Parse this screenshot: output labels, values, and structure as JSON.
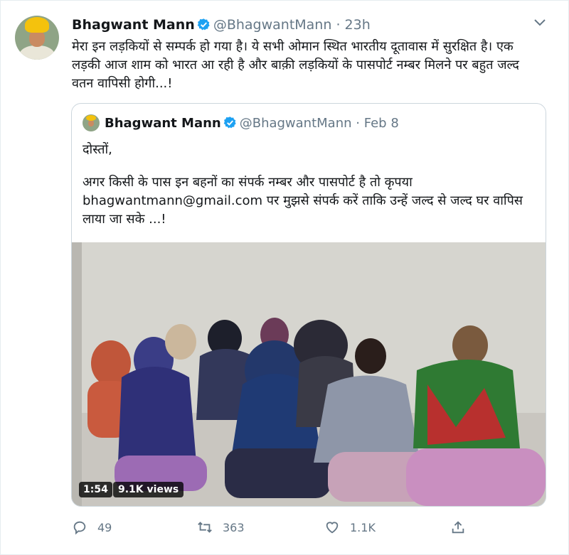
{
  "tweet": {
    "author_name": "Bhagwant Mann",
    "handle": "@BhagwantMann",
    "separator": "·",
    "time": "23h",
    "text": "मेरा इन लड़कियों से सम्पर्क हो गया है। ये सभी ओमान स्थित भारतीय दूतावास में सुरक्षित है। एक लड़की आज शाम को भारत आ रही है और बाक़ी लड़कियों के पासपोर्ट नम्बर मिलने पर  बहुत जल्द वतन वापिसी होगी...!",
    "icons": {
      "verified": "verified-badge-icon",
      "more": "chevron-down-icon"
    }
  },
  "quoted": {
    "author_name": "Bhagwant Mann",
    "handle": "@BhagwantMann",
    "separator": "·",
    "date": "Feb 8",
    "line1": "दोस्तों,",
    "line2": "अगर किसी के पास इन बहनों का संपर्क नम्बर और पासपोर्ट है तो कृपया bhagwantmann@gmail.com पर मुझसे संपर्क करें ताकि उन्हें जल्द से जल्द घर वापिस लाया जा सके ...!",
    "video": {
      "duration": "1:54",
      "views": "9.1K views"
    }
  },
  "actions": {
    "reply_count": "49",
    "retweet_count": "363",
    "like_count": "1.1K",
    "icons": [
      "reply-icon",
      "retweet-icon",
      "like-icon",
      "share-icon"
    ]
  },
  "colors": {
    "verified": "#1da1f2",
    "secondary_text": "#657786",
    "border": "#ccd6dd"
  }
}
